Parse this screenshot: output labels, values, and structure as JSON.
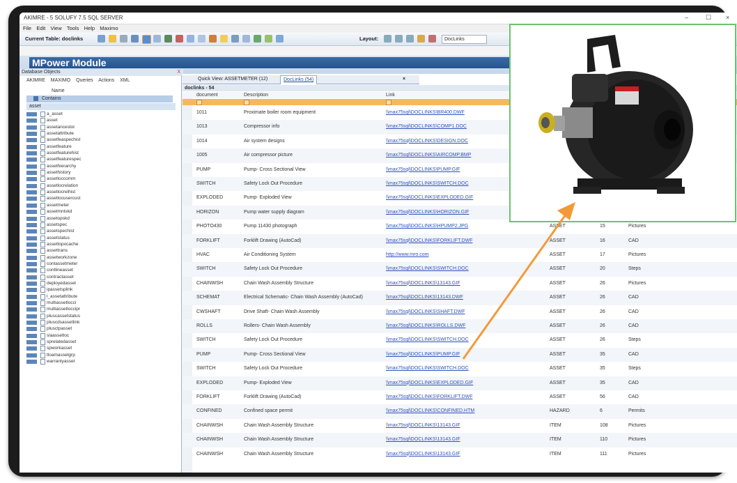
{
  "window": {
    "title": "AKIMRE - 5 SOLUFY 7.5 SQL SERVER",
    "controls": [
      "–",
      "☐",
      "×"
    ]
  },
  "menu": [
    "File",
    "Edit",
    "View",
    "Tools",
    "Help",
    "Maximo"
  ],
  "toolbar": {
    "current_table_label": "Current Table: doclinks",
    "layout_label": "Layout:",
    "layout_value": "DocLinks"
  },
  "module_title": "MPower Module",
  "left_panel": {
    "header": "Database Objects",
    "close": "X",
    "tabs": [
      "AKIMRE",
      "MAXIMO",
      "Queries",
      "Actions",
      "XML"
    ],
    "name_label": "Name",
    "contains_label": "Contains",
    "filter_value": "asset",
    "items": [
      "a_asset",
      "asset",
      "assetancestor",
      "assetattribute",
      "assetfeaspechist",
      "assetfeature",
      "assetfeaturehist",
      "assetfeaturespec",
      "assethierarchy",
      "assethistory",
      "assetloccomm",
      "assetlocrelation",
      "assetlocrelhist",
      "assetlocusercust",
      "assetmeter",
      "assetmntskd",
      "assetopskd",
      "assetspec",
      "assetspechist",
      "assetstatus",
      "assettopocache",
      "assettrans",
      "assetworkzone",
      "contassetmeter",
      "contlineasset",
      "contractasset",
      "deployedasset",
      "ipassetsplink",
      "l_assetattribute",
      "multiassetlocci",
      "multiassetloccipr",
      "pluscassetstatus",
      "pluscdsassetlink",
      "plusctpasset",
      "slaassetloc",
      "sprelatedasset",
      "spworkasset",
      "tloamassetgrp",
      "warrantyasset"
    ]
  },
  "tabs": {
    "quick_view": "Quick View: ASSETMETER (12)",
    "doclinks": "DocLinks (54)",
    "close": "×"
  },
  "table": {
    "title": "doclinks - 54",
    "columns": [
      "document",
      "Description",
      "Link"
    ],
    "rows": [
      {
        "document": "1011",
        "description": "Proximate boiler room equipment",
        "link": "\\\\max75sql\\DOCLINKS\\BR400.DWF",
        "ownertable": "",
        "ownerid": "",
        "type": ""
      },
      {
        "document": "1013",
        "description": "Compressor info",
        "link": "\\\\max75sql\\DOCLINKS\\COMP1.DOC",
        "ownertable": "",
        "ownerid": "",
        "type": ""
      },
      {
        "document": "1014",
        "description": "Air system designs",
        "link": "\\\\max75sql\\DOCLINKS\\DESIGN.DOC",
        "ownertable": "",
        "ownerid": "",
        "type": ""
      },
      {
        "document": "1005",
        "description": "Air compressor picture",
        "link": "\\\\max75sql\\DOCLINKS\\AIRCOMP.BMP",
        "ownertable": "",
        "ownerid": "",
        "type": ""
      },
      {
        "document": "PUMP",
        "description": "Pump- Cross Sectional View",
        "link": "\\\\max75sql\\DOCLINKS\\PUMP.GIF",
        "ownertable": "",
        "ownerid": "",
        "type": ""
      },
      {
        "document": "SWITCH",
        "description": "Safety Lock Out Procedure",
        "link": "\\\\max75sql\\DOCLINKS\\SWITCH.DOC",
        "ownertable": "",
        "ownerid": "",
        "type": ""
      },
      {
        "document": "EXPLODED",
        "description": "Pump- Exploded View",
        "link": "\\\\max75sql\\DOCLINKS\\EXPLODED.GIF",
        "ownertable": "",
        "ownerid": "",
        "type": ""
      },
      {
        "document": "HORIZON",
        "description": "Pump water supply diagram",
        "link": "\\\\max75sql\\DOCLINKS\\HORIZON.GIF",
        "ownertable": "ASSET",
        "ownerid": "15",
        "type": "Parts"
      },
      {
        "document": "PHOTO430",
        "description": "Pump 11430 photograph",
        "link": "\\\\max75sql\\DOCLINKS\\HPUMP2.JPG",
        "ownertable": "ASSET",
        "ownerid": "15",
        "type": "Pictures"
      },
      {
        "document": "FORKLIFT",
        "description": "Forklift Drawing (AutoCad)",
        "link": "\\\\max75sql\\DOCLINKS\\FORKLIFT.DWF",
        "ownertable": "ASSET",
        "ownerid": "16",
        "type": "CAD"
      },
      {
        "document": "HVAC",
        "description": "Air Conditioning System",
        "link": "http://www.mro.com",
        "ownertable": "ASSET",
        "ownerid": "17",
        "type": "Pictures"
      },
      {
        "document": "SWITCH",
        "description": "Safety Lock Out Procedure",
        "link": "\\\\max75sql\\DOCLINKS\\SWITCH.DOC",
        "ownertable": "ASSET",
        "ownerid": "20",
        "type": "Steps"
      },
      {
        "document": "CHAINWSH",
        "description": "Chain Wash Assembly Structure",
        "link": "\\\\max75sql\\DOCLINKS\\13143.GIF",
        "ownertable": "ASSET",
        "ownerid": "26",
        "type": "Pictures"
      },
      {
        "document": "SCHEMAT",
        "description": "Electrical Schematic- Chain Wash Assembly (AutoCad)",
        "link": "\\\\max75sql\\DOCLINKS\\13143.DWF",
        "ownertable": "ASSET",
        "ownerid": "26",
        "type": "CAD"
      },
      {
        "document": "CWSHAFT",
        "description": "Drive Shaft- Chain Wash Assembly",
        "link": "\\\\max75sql\\DOCLINKS\\SHAFT.DWF",
        "ownertable": "ASSET",
        "ownerid": "26",
        "type": "CAD"
      },
      {
        "document": "ROLLS",
        "description": "Rollers- Chain Wash Assembly",
        "link": "\\\\max75sql\\DOCLINKS\\ROLLS.DWF",
        "ownertable": "ASSET",
        "ownerid": "26",
        "type": "CAD"
      },
      {
        "document": "SWITCH",
        "description": "Safety Lock Out Procedure",
        "link": "\\\\max75sql\\DOCLINKS\\SWITCH.DOC",
        "ownertable": "ASSET",
        "ownerid": "26",
        "type": "Steps"
      },
      {
        "document": "PUMP",
        "description": "Pump- Cross Sectional View",
        "link": "\\\\max75sql\\DOCLINKS\\PUMP.GIF",
        "ownertable": "ASSET",
        "ownerid": "35",
        "type": "CAD"
      },
      {
        "document": "SWITCH",
        "description": "Safety Lock Out Procedure",
        "link": "\\\\max75sql\\DOCLINKS\\SWITCH.DOC",
        "ownertable": "ASSET",
        "ownerid": "35",
        "type": "Steps"
      },
      {
        "document": "EXPLODED",
        "description": "Pump- Exploded View",
        "link": "\\\\max75sql\\DOCLINKS\\EXPLODED.GIF",
        "ownertable": "ASSET",
        "ownerid": "35",
        "type": "CAD"
      },
      {
        "document": "FORKLIFT",
        "description": "Forklift Drawing (AutoCad)",
        "link": "\\\\max75sql\\DOCLINKS\\FORKLIFT.DWF",
        "ownertable": "ASSET",
        "ownerid": "56",
        "type": "CAD"
      },
      {
        "document": "CONFINED",
        "description": "Confined space permit",
        "link": "\\\\max75sql\\DOCLINKS\\CONFINED.HTM",
        "ownertable": "HAZARD",
        "ownerid": "6",
        "type": "Permits"
      },
      {
        "document": "CHAINWSH",
        "description": "Chain Wash Assembly Structure",
        "link": "\\\\max75sql\\DOCLINKS\\13143.GIF",
        "ownertable": "ITEM",
        "ownerid": "108",
        "type": "Pictures"
      },
      {
        "document": "CHAINWSH",
        "description": "Chain Wash Assembly Structure",
        "link": "\\\\max75sql\\DOCLINKS\\13143.GIF",
        "ownertable": "ITEM",
        "ownerid": "110",
        "type": "Pictures"
      },
      {
        "document": "CHAINWSH",
        "description": "Chain Wash Assembly Structure",
        "link": "\\\\max75sql\\DOCLINKS\\13143.GIF",
        "ownertable": "ITEM",
        "ownerid": "111",
        "type": "Pictures"
      }
    ]
  },
  "colors": {
    "module_banner": "#26548f",
    "filter_row": "#f7b85c",
    "callout_arrow": "#f29a38",
    "popup_border": "#6cc26c",
    "link": "#3050b8"
  },
  "popup": {
    "image": "pump-photo"
  }
}
